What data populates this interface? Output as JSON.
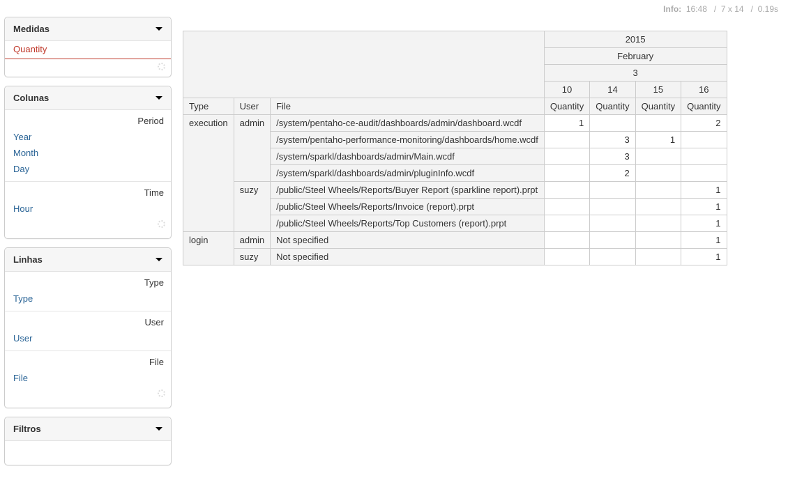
{
  "info": {
    "label": "Info:",
    "time": "16:48",
    "dims": "7 x 14",
    "elapsed": "0.19s",
    "sep": "/"
  },
  "panels": {
    "medidas": {
      "title": "Medidas",
      "items": [
        "Quantity"
      ]
    },
    "colunas": {
      "title": "Colunas",
      "groups": [
        {
          "label": "Period",
          "items": [
            "Year",
            "Month",
            "Day"
          ]
        },
        {
          "label": "Time",
          "items": [
            "Hour"
          ]
        }
      ]
    },
    "linhas": {
      "title": "Linhas",
      "groups": [
        {
          "label": "Type",
          "items": [
            "Type"
          ]
        },
        {
          "label": "User",
          "items": [
            "User"
          ]
        },
        {
          "label": "File",
          "items": [
            "File"
          ]
        }
      ]
    },
    "filtros": {
      "title": "Filtros"
    }
  },
  "pivot": {
    "col_levels": {
      "year": "2015",
      "month": "February",
      "day": "3"
    },
    "hours": [
      "10",
      "14",
      "15",
      "16"
    ],
    "measure": "Quantity",
    "row_headers": [
      "Type",
      "User",
      "File"
    ],
    "rows": [
      {
        "type": "execution",
        "user": "admin",
        "file": "/system/pentaho-ce-audit/dashboards/admin/dashboard.wcdf",
        "vals": [
          "1",
          "",
          "",
          "2"
        ]
      },
      {
        "type": "",
        "user": "",
        "file": "/system/pentaho-performance-monitoring/dashboards/home.wcdf",
        "vals": [
          "",
          "3",
          "1",
          ""
        ]
      },
      {
        "type": "",
        "user": "",
        "file": "/system/sparkl/dashboards/admin/Main.wcdf",
        "vals": [
          "",
          "3",
          "",
          ""
        ]
      },
      {
        "type": "",
        "user": "",
        "file": "/system/sparkl/dashboards/admin/pluginInfo.wcdf",
        "vals": [
          "",
          "2",
          "",
          ""
        ]
      },
      {
        "type": "",
        "user": "suzy",
        "file": "/public/Steel Wheels/Reports/Buyer Report (sparkline report).prpt",
        "vals": [
          "",
          "",
          "",
          "1"
        ]
      },
      {
        "type": "",
        "user": "",
        "file": "/public/Steel Wheels/Reports/Invoice (report).prpt",
        "vals": [
          "",
          "",
          "",
          "1"
        ]
      },
      {
        "type": "",
        "user": "",
        "file": "/public/Steel Wheels/Reports/Top Customers (report).prpt",
        "vals": [
          "",
          "",
          "",
          "1"
        ]
      },
      {
        "type": "login",
        "user": "admin",
        "file": "Not specified",
        "vals": [
          "",
          "",
          "",
          "1"
        ]
      },
      {
        "type": "",
        "user": "suzy",
        "file": "Not specified",
        "vals": [
          "",
          "",
          "",
          "1"
        ]
      }
    ],
    "row_spans": {
      "type": [
        4,
        0,
        0,
        0,
        3,
        0,
        0,
        2,
        0
      ],
      "user": [
        4,
        0,
        0,
        0,
        3,
        0,
        0,
        1,
        1
      ],
      "type_merge_user": [
        7,
        0,
        0,
        0,
        0,
        0,
        0,
        2,
        0
      ]
    }
  }
}
